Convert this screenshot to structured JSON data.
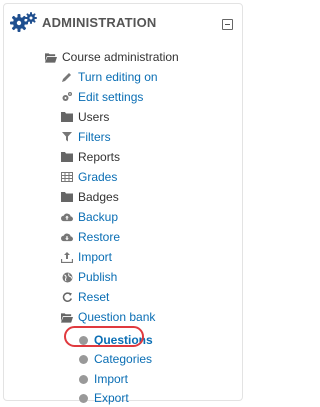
{
  "block": {
    "title": "ADMINISTRATION",
    "gear_icon": "gears-icon",
    "collapse_icon": "minus-square-icon"
  },
  "tree": {
    "root": {
      "label": "Course administration",
      "icon": "folder-open-icon"
    },
    "items": [
      {
        "label": "Turn editing on",
        "icon": "pencil-icon"
      },
      {
        "label": "Edit settings",
        "icon": "cog-icon"
      },
      {
        "label": "Users",
        "icon": "folder-icon"
      },
      {
        "label": "Filters",
        "icon": "filter-icon"
      },
      {
        "label": "Reports",
        "icon": "folder-icon"
      },
      {
        "label": "Grades",
        "icon": "table-icon"
      },
      {
        "label": "Badges",
        "icon": "folder-icon"
      },
      {
        "label": "Backup",
        "icon": "cloud-upload-icon"
      },
      {
        "label": "Restore",
        "icon": "cloud-download-icon"
      },
      {
        "label": "Import",
        "icon": "upload-icon"
      },
      {
        "label": "Publish",
        "icon": "globe-icon"
      },
      {
        "label": "Reset",
        "icon": "reset-icon"
      },
      {
        "label": "Question bank",
        "icon": "folder-open-icon"
      }
    ],
    "question_bank_items": [
      {
        "label": "Questions",
        "icon": "bullet-icon"
      },
      {
        "label": "Categories",
        "icon": "bullet-icon"
      },
      {
        "label": "Import",
        "icon": "bullet-icon"
      },
      {
        "label": "Export",
        "icon": "bullet-icon"
      }
    ]
  },
  "colors": {
    "link": "#0a6eb4",
    "highlight": "#e0393e",
    "text": "#333333"
  }
}
